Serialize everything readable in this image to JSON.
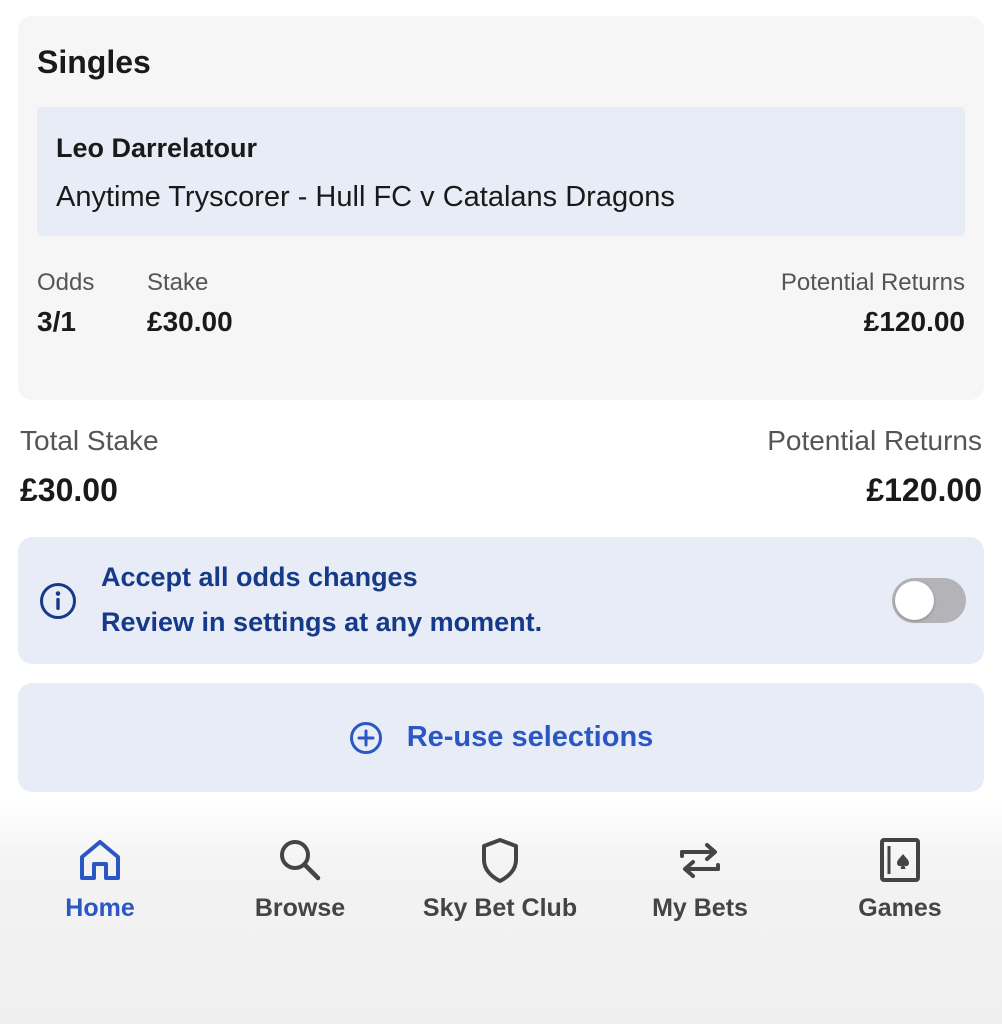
{
  "singles": {
    "title": "Singles",
    "selection": {
      "name": "Leo Darrelatour",
      "market": "Anytime Tryscorer - Hull FC v Catalans Dragons"
    },
    "odds_label": "Odds",
    "odds_value": "3/1",
    "stake_label": "Stake",
    "stake_value": "£30.00",
    "returns_label": "Potential Returns",
    "returns_value": "£120.00"
  },
  "totals": {
    "stake_label": "Total Stake",
    "stake_value": "£30.00",
    "returns_label": "Potential Returns",
    "returns_value": "£120.00"
  },
  "odds_changes": {
    "icon": "info-icon",
    "title": "Accept all odds changes",
    "subtitle": "Review in settings at any moment.",
    "toggle_on": false
  },
  "reuse": {
    "icon": "plus-circle-icon",
    "label": "Re-use selections"
  },
  "nav": {
    "items": [
      {
        "label": "Home",
        "icon": "home-icon",
        "active": true
      },
      {
        "label": "Browse",
        "icon": "search-icon",
        "active": false
      },
      {
        "label": "Sky Bet Club",
        "icon": "shield-icon",
        "active": false
      },
      {
        "label": "My Bets",
        "icon": "swap-arrows-icon",
        "active": false
      },
      {
        "label": "Games",
        "icon": "playing-card-icon",
        "active": false
      }
    ]
  },
  "colors": {
    "accent_blue": "#2a57c4",
    "dark_blue_text": "#163a8a",
    "panel_blue": "#e8ecf6",
    "card_grey": "#f6f6f6",
    "toggle_off": "#b4b4b8"
  }
}
